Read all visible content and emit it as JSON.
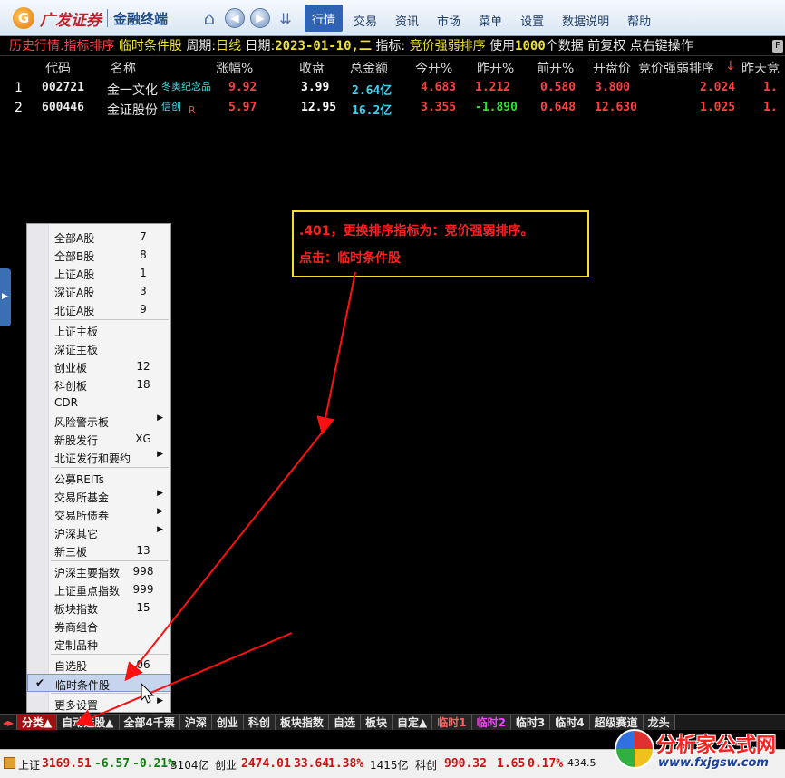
{
  "app": {
    "logo_text": "广发证券",
    "subtitle": "金融终端"
  },
  "menu": [
    "行情",
    "交易",
    "资讯",
    "市场",
    "菜单",
    "设置",
    "数据说明",
    "帮助"
  ],
  "titlebar": {
    "prefix": "历史行情.指标排序",
    "cond": "临时条件股",
    "period_label": "周期:",
    "period": "日线",
    "date_label": "日期:",
    "date": "2023-01-10,二",
    "indicator_label": "指标:",
    "indicator": "竞价强弱排序",
    "use_label": "使用",
    "use_count": "1000",
    "use_tail": "个数据",
    "fq": "前复权",
    "op": "点右键操作"
  },
  "table": {
    "headers": [
      "代码",
      "名称",
      "涨幅%",
      "收盘",
      "总金额",
      "今开%",
      "昨开%",
      "前开%",
      "开盘价",
      "竞价强弱排序",
      "↓",
      "昨天竞"
    ],
    "rows": [
      {
        "idx": "1",
        "code": "002721",
        "name": "金一文化",
        "tag": "冬奥纪念品",
        "tagR": "",
        "chg": "9.92",
        "close": "3.99",
        "amt": "2.64亿",
        "jk": "4.683",
        "zk": "1.212",
        "qk": "0.580",
        "open": "3.800",
        "rank": "2.024",
        "prev": "1."
      },
      {
        "idx": "2",
        "code": "600446",
        "name": "金证股份",
        "tag": "信创",
        "tagR": "R",
        "chg": "5.97",
        "close": "12.95",
        "amt": "16.2亿",
        "jk": "3.355",
        "zk": "-1.890",
        "qk": "0.648",
        "open": "12.630",
        "rank": "1.025",
        "prev": "1."
      }
    ]
  },
  "note": {
    "line1": ".401，更换排序指标为：竞价强弱排序。",
    "line2": "点击：临时条件股"
  },
  "popup": [
    {
      "label": "全部A股",
      "key": "7"
    },
    {
      "label": "全部B股",
      "key": "8"
    },
    {
      "label": "上证A股",
      "key": "1"
    },
    {
      "label": "深证A股",
      "key": "3"
    },
    {
      "label": "北证A股",
      "key": "9"
    },
    {
      "sep": true
    },
    {
      "label": "上证主板",
      "key": ""
    },
    {
      "label": "深证主板",
      "key": ""
    },
    {
      "label": "创业板",
      "key": "12"
    },
    {
      "label": "科创板",
      "key": "18"
    },
    {
      "label": "CDR",
      "key": ""
    },
    {
      "label": "风险警示板",
      "key": "",
      "sub": true
    },
    {
      "label": "新股发行",
      "key": "XG"
    },
    {
      "label": "北证发行和要约",
      "key": "",
      "sub": true
    },
    {
      "sep": true
    },
    {
      "label": "公募REITs",
      "key": ""
    },
    {
      "label": "交易所基金",
      "key": "",
      "sub": true
    },
    {
      "label": "交易所债券",
      "key": "",
      "sub": true
    },
    {
      "label": "沪深其它",
      "key": "",
      "sub": true
    },
    {
      "label": "新三板",
      "key": "13"
    },
    {
      "sep": true
    },
    {
      "label": "沪深主要指数",
      "key": "998"
    },
    {
      "label": "上证重点指数",
      "key": "999"
    },
    {
      "label": "板块指数",
      "key": "15"
    },
    {
      "label": "券商组合",
      "key": ""
    },
    {
      "label": "定制品种",
      "key": ""
    },
    {
      "sep": true
    },
    {
      "label": "自选股",
      "key": "06"
    },
    {
      "label": "临时条件股",
      "key": "",
      "checked": true,
      "selected": true
    },
    {
      "sep": true
    },
    {
      "label": "更多设置",
      "key": "",
      "sub": true
    }
  ],
  "tabs": [
    "◂▸",
    "分类▲",
    "自动选股▲",
    "全部4千票",
    "沪深",
    "创业",
    "科创",
    "板块指数",
    "自选",
    "板块",
    "自定▲",
    "临时1",
    "临时2",
    "临时3",
    "临时4",
    "超级赛道",
    "龙头"
  ],
  "status": {
    "sh_label": "上证",
    "sh_val": "3169.51",
    "sh_chg": "-6.57",
    "sh_pct": "-0.21%",
    "sh_amt": "3104亿",
    "cy_label": "创业",
    "cy_val": "2474.01",
    "cy_chg": "33.64",
    "cy_pct": "1.38%",
    "cy_amt": "1415亿",
    "kc_label": "科创",
    "kc_val": "990.32",
    "kc_chg": "1.65",
    "kc_pct": "0.17%",
    "kc_amt": "434.5"
  },
  "watermark": {
    "text": "分析家公式网",
    "url": "www.fxjgsw.com"
  },
  "colors": {
    "accent": "#2f64b4",
    "up": "#ff4040",
    "down": "#30e030",
    "note_border": "#f0e030"
  }
}
